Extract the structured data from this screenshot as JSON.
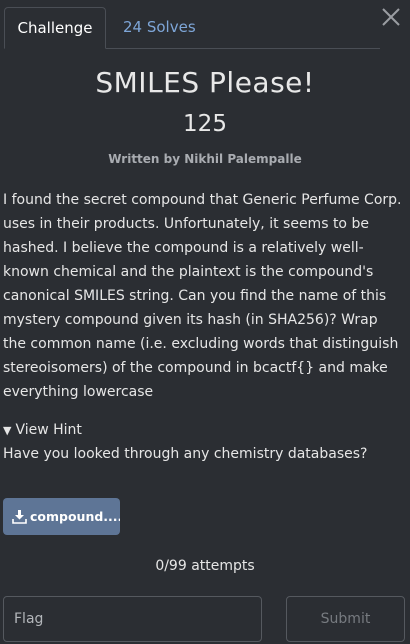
{
  "tabs": [
    {
      "label": "Challenge"
    },
    {
      "label": "24 Solves"
    }
  ],
  "challenge": {
    "title": "SMILES Please!",
    "points": "125",
    "author": "Written by Nikhil Palempalle",
    "description": "I found the secret compound that Generic Perfume Corp. uses in their products. Unfortunately, it seems to be hashed. I believe the compound is a relatively well-known chemical and the plaintext is the compound's canonical SMILES string. Can you find the name of this mystery compound given its hash (in SHA256)? Wrap the common name (i.e. excluding words that distinguish stereoisomers) of the compound in bcactf{} and make everything lowercase"
  },
  "hint": {
    "toggle_label": "View Hint",
    "text": "Have you looked through any chemistry databases?"
  },
  "file": {
    "label": "compound...."
  },
  "attempts": "0/99 attempts",
  "flag_form": {
    "placeholder": "Flag",
    "value": "",
    "submit_label": "Submit"
  },
  "colors": {
    "background": "#2b2e33",
    "tab_link": "#7ea6d8",
    "file_button": "#5e7596"
  },
  "icons": {
    "close": "close-icon",
    "hint_caret": "caret-down-icon",
    "download": "download-icon"
  }
}
